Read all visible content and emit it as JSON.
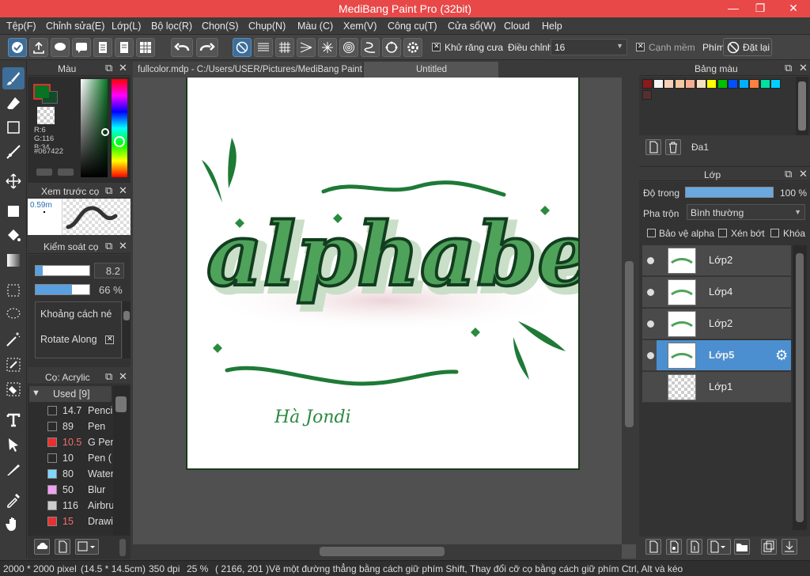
{
  "window": {
    "title": "MediBang Paint Pro (32bit)"
  },
  "menu": [
    "Tệp(F)",
    "Chỉnh sửa(E)",
    "Lớp(L)",
    "Bộ lọc(R)",
    "Chọn(S)",
    "Chụp(N)",
    "Màu (C)",
    "Xem(V)",
    "Công cụ(T)",
    "Cửa sổ(W)",
    "Cloud",
    "Help"
  ],
  "toolbar": {
    "antialias_label": "Khử răng cưa",
    "adjust_label": "Điều chỉnh",
    "adjust_value": "16",
    "edge_label": "Cạnh mềm",
    "key_label": "Phím",
    "reset_label": "Đặt lại"
  },
  "color_panel": {
    "title": "Màu",
    "r": "R:6",
    "g": "G:116",
    "b": "B:34",
    "hex": "#067422",
    "primary": "#067422"
  },
  "brush_preview": {
    "title": "Xem trước cọ",
    "size": "0.59m"
  },
  "brush_control": {
    "title": "Kiểm soát cọ",
    "size_value": "8.2",
    "opacity_value": "66 %",
    "spacing_label": "Khoảng cách né",
    "rotate_label": "Rotate Along"
  },
  "brush_list": {
    "title": "Cọ: Acrylic",
    "group": "Used [9]",
    "items": [
      {
        "size": "14.7",
        "name": "Pencil",
        "color": "#2a2a2a"
      },
      {
        "size": "89",
        "name": "Pen",
        "color": "#2a2a2a"
      },
      {
        "size": "10.5",
        "name": "G Pen",
        "color": "#e83030"
      },
      {
        "size": "10",
        "name": "Pen (",
        "color": "#2a2a2a"
      },
      {
        "size": "80",
        "name": "Watercolor",
        "color": "#7fd6ff"
      },
      {
        "size": "50",
        "name": "Blur",
        "color": "#f0a0f0"
      },
      {
        "size": "116",
        "name": "Airbrush",
        "color": "#cccccc"
      },
      {
        "size": "15",
        "name": "Drawing",
        "color": "#e83030"
      }
    ]
  },
  "document": {
    "tab1": "fullcolor.mdp - C:/Users/USER/Pictures/MediBang Paint Pro",
    "tab2": "Untitled"
  },
  "palette": {
    "title": "Bảng màu",
    "colors": [
      "#8b1a1a",
      "#f5f5f5",
      "#f5d0b8",
      "#f5c8a0",
      "#f5b090",
      "#f5e0c0",
      "#ffff00",
      "#00c000",
      "#0050ff",
      "#00b0ff",
      "#ff8040",
      "#00e0a0",
      "#00d0ff"
    ],
    "set_name": "Đa1"
  },
  "layers": {
    "title": "Lớp",
    "opacity_label": "Độ trong",
    "opacity_value": "100 %",
    "blend_label": "Pha trộn",
    "blend_value": "Bình thường",
    "protect_alpha": "Bảo vệ alpha",
    "clipping": "Xén bớt",
    "lock": "Khóa",
    "items": [
      {
        "name": "Lớp2",
        "selected": false
      },
      {
        "name": "Lớp4",
        "selected": false
      },
      {
        "name": "Lớp2",
        "selected": false
      },
      {
        "name": "Lớp5",
        "selected": true
      },
      {
        "name": "Lớp1",
        "selected": false
      }
    ]
  },
  "status": {
    "size": "2000 * 2000 pixel",
    "physical": "(14.5 * 14.5cm)",
    "dpi": "350 dpi",
    "zoom": "25 %",
    "coords": "( 2166, 201 )",
    "hint": "Vẽ một đường thẳng bằng cách giữ phím Shift, Thay đổi cỡ cọ bằng cách giữ phím Ctrl, Alt và kéo"
  },
  "artwork": {
    "word": "alphabet",
    "signature": "Hà Jondi"
  }
}
